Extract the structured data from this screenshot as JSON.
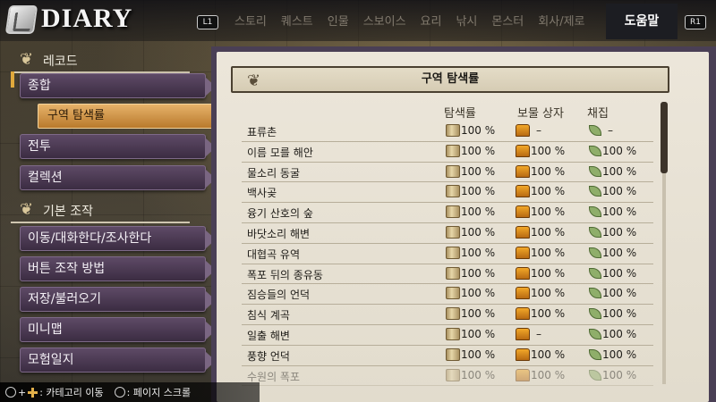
{
  "header": {
    "app_title": "DIARY",
    "l1": "L1",
    "r1": "R1",
    "tabs": [
      "스토리",
      "퀘스트",
      "인물",
      "스보이스",
      "요리",
      "낚시",
      "몬스터",
      "회사/제로"
    ],
    "active_tab": "도움말"
  },
  "sidebar": {
    "section_record": "레코드",
    "section_basic": "기본 조작",
    "items": {
      "overall": "종합",
      "exploration": "구역 탐색률",
      "battle": "전투",
      "collection": "컬렉션",
      "move": "이동/대화한다/조사한다",
      "buttons": "버튼 조작 방법",
      "save": "저장/불러오기",
      "minimap": "미니맵",
      "journal": "모험일지"
    }
  },
  "panel": {
    "title": "구역 탐색률",
    "col_explore": "탐색률",
    "col_chest": "보물 상자",
    "col_gather": "채집"
  },
  "rows": [
    {
      "name": "표류촌",
      "explore": "100 %",
      "chest": "–",
      "gather": "–"
    },
    {
      "name": "이름 모를 해안",
      "explore": "100 %",
      "chest": "100 %",
      "gather": "100 %"
    },
    {
      "name": "물소리 동굴",
      "explore": "100 %",
      "chest": "100 %",
      "gather": "100 %"
    },
    {
      "name": "백사곶",
      "explore": "100 %",
      "chest": "100 %",
      "gather": "100 %"
    },
    {
      "name": "융기 산호의 숲",
      "explore": "100 %",
      "chest": "100 %",
      "gather": "100 %"
    },
    {
      "name": "바닷소리 해변",
      "explore": "100 %",
      "chest": "100 %",
      "gather": "100 %"
    },
    {
      "name": "대협곡 유역",
      "explore": "100 %",
      "chest": "100 %",
      "gather": "100 %"
    },
    {
      "name": "폭포 뒤의 종유동",
      "explore": "100 %",
      "chest": "100 %",
      "gather": "100 %"
    },
    {
      "name": "짐승들의 언덕",
      "explore": "100 %",
      "chest": "100 %",
      "gather": "100 %"
    },
    {
      "name": "침식 계곡",
      "explore": "100 %",
      "chest": "100 %",
      "gather": "100 %"
    },
    {
      "name": "일출 해변",
      "explore": "100 %",
      "chest": "–",
      "gather": "100 %"
    },
    {
      "name": "풍향 언덕",
      "explore": "100 %",
      "chest": "100 %",
      "gather": "100 %"
    },
    {
      "name": "수원의 폭포",
      "explore": "100 %",
      "chest": "100 %",
      "gather": "100 %"
    }
  ],
  "footer": {
    "category_hint": ": 카테고리 이동",
    "scroll_hint": ": 페이지 스크롤"
  }
}
